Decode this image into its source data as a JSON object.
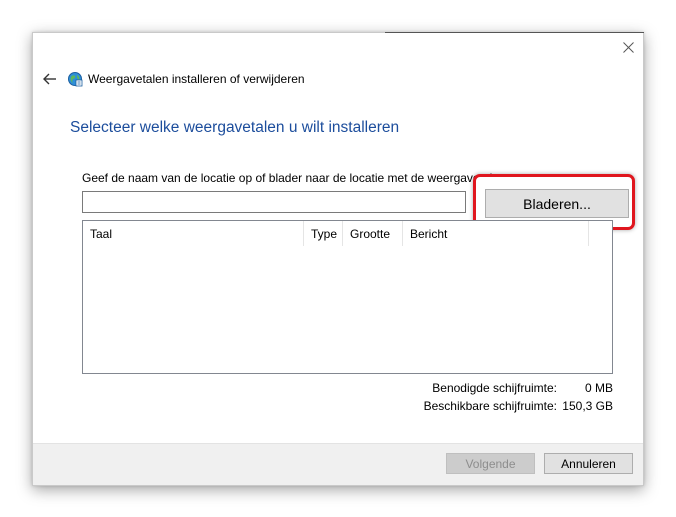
{
  "window": {
    "close_symbol": "×"
  },
  "header": {
    "back_icon": "arrow-left-icon",
    "app_icon": "globe-language-icon",
    "title": "Weergavetalen installeren of verwijderen"
  },
  "main": {
    "heading": "Selecteer welke weergavetalen u wilt installeren",
    "instruction": "Geef de naam van de locatie op of blader naar de locatie met de weergavetalen:",
    "path_input": {
      "value": "",
      "placeholder": ""
    },
    "browse_button": "Bladeren..."
  },
  "table": {
    "columns": [
      "Taal",
      "Type",
      "Grootte",
      "Bericht"
    ],
    "rows": []
  },
  "disk_space": {
    "required_label": "Benodigde schijfruimte:",
    "required_value": "0 MB",
    "available_label": "Beschikbare schijfruimte:",
    "available_value": "150,3 GB"
  },
  "footer": {
    "next_label": "Volgende",
    "next_enabled": false,
    "cancel_label": "Annuleren"
  },
  "colors": {
    "heading": "#1c4d9c",
    "highlight_border": "#e0161e",
    "disabled_text": "#8d8d8d",
    "footer_bg": "#f0f0f0"
  }
}
